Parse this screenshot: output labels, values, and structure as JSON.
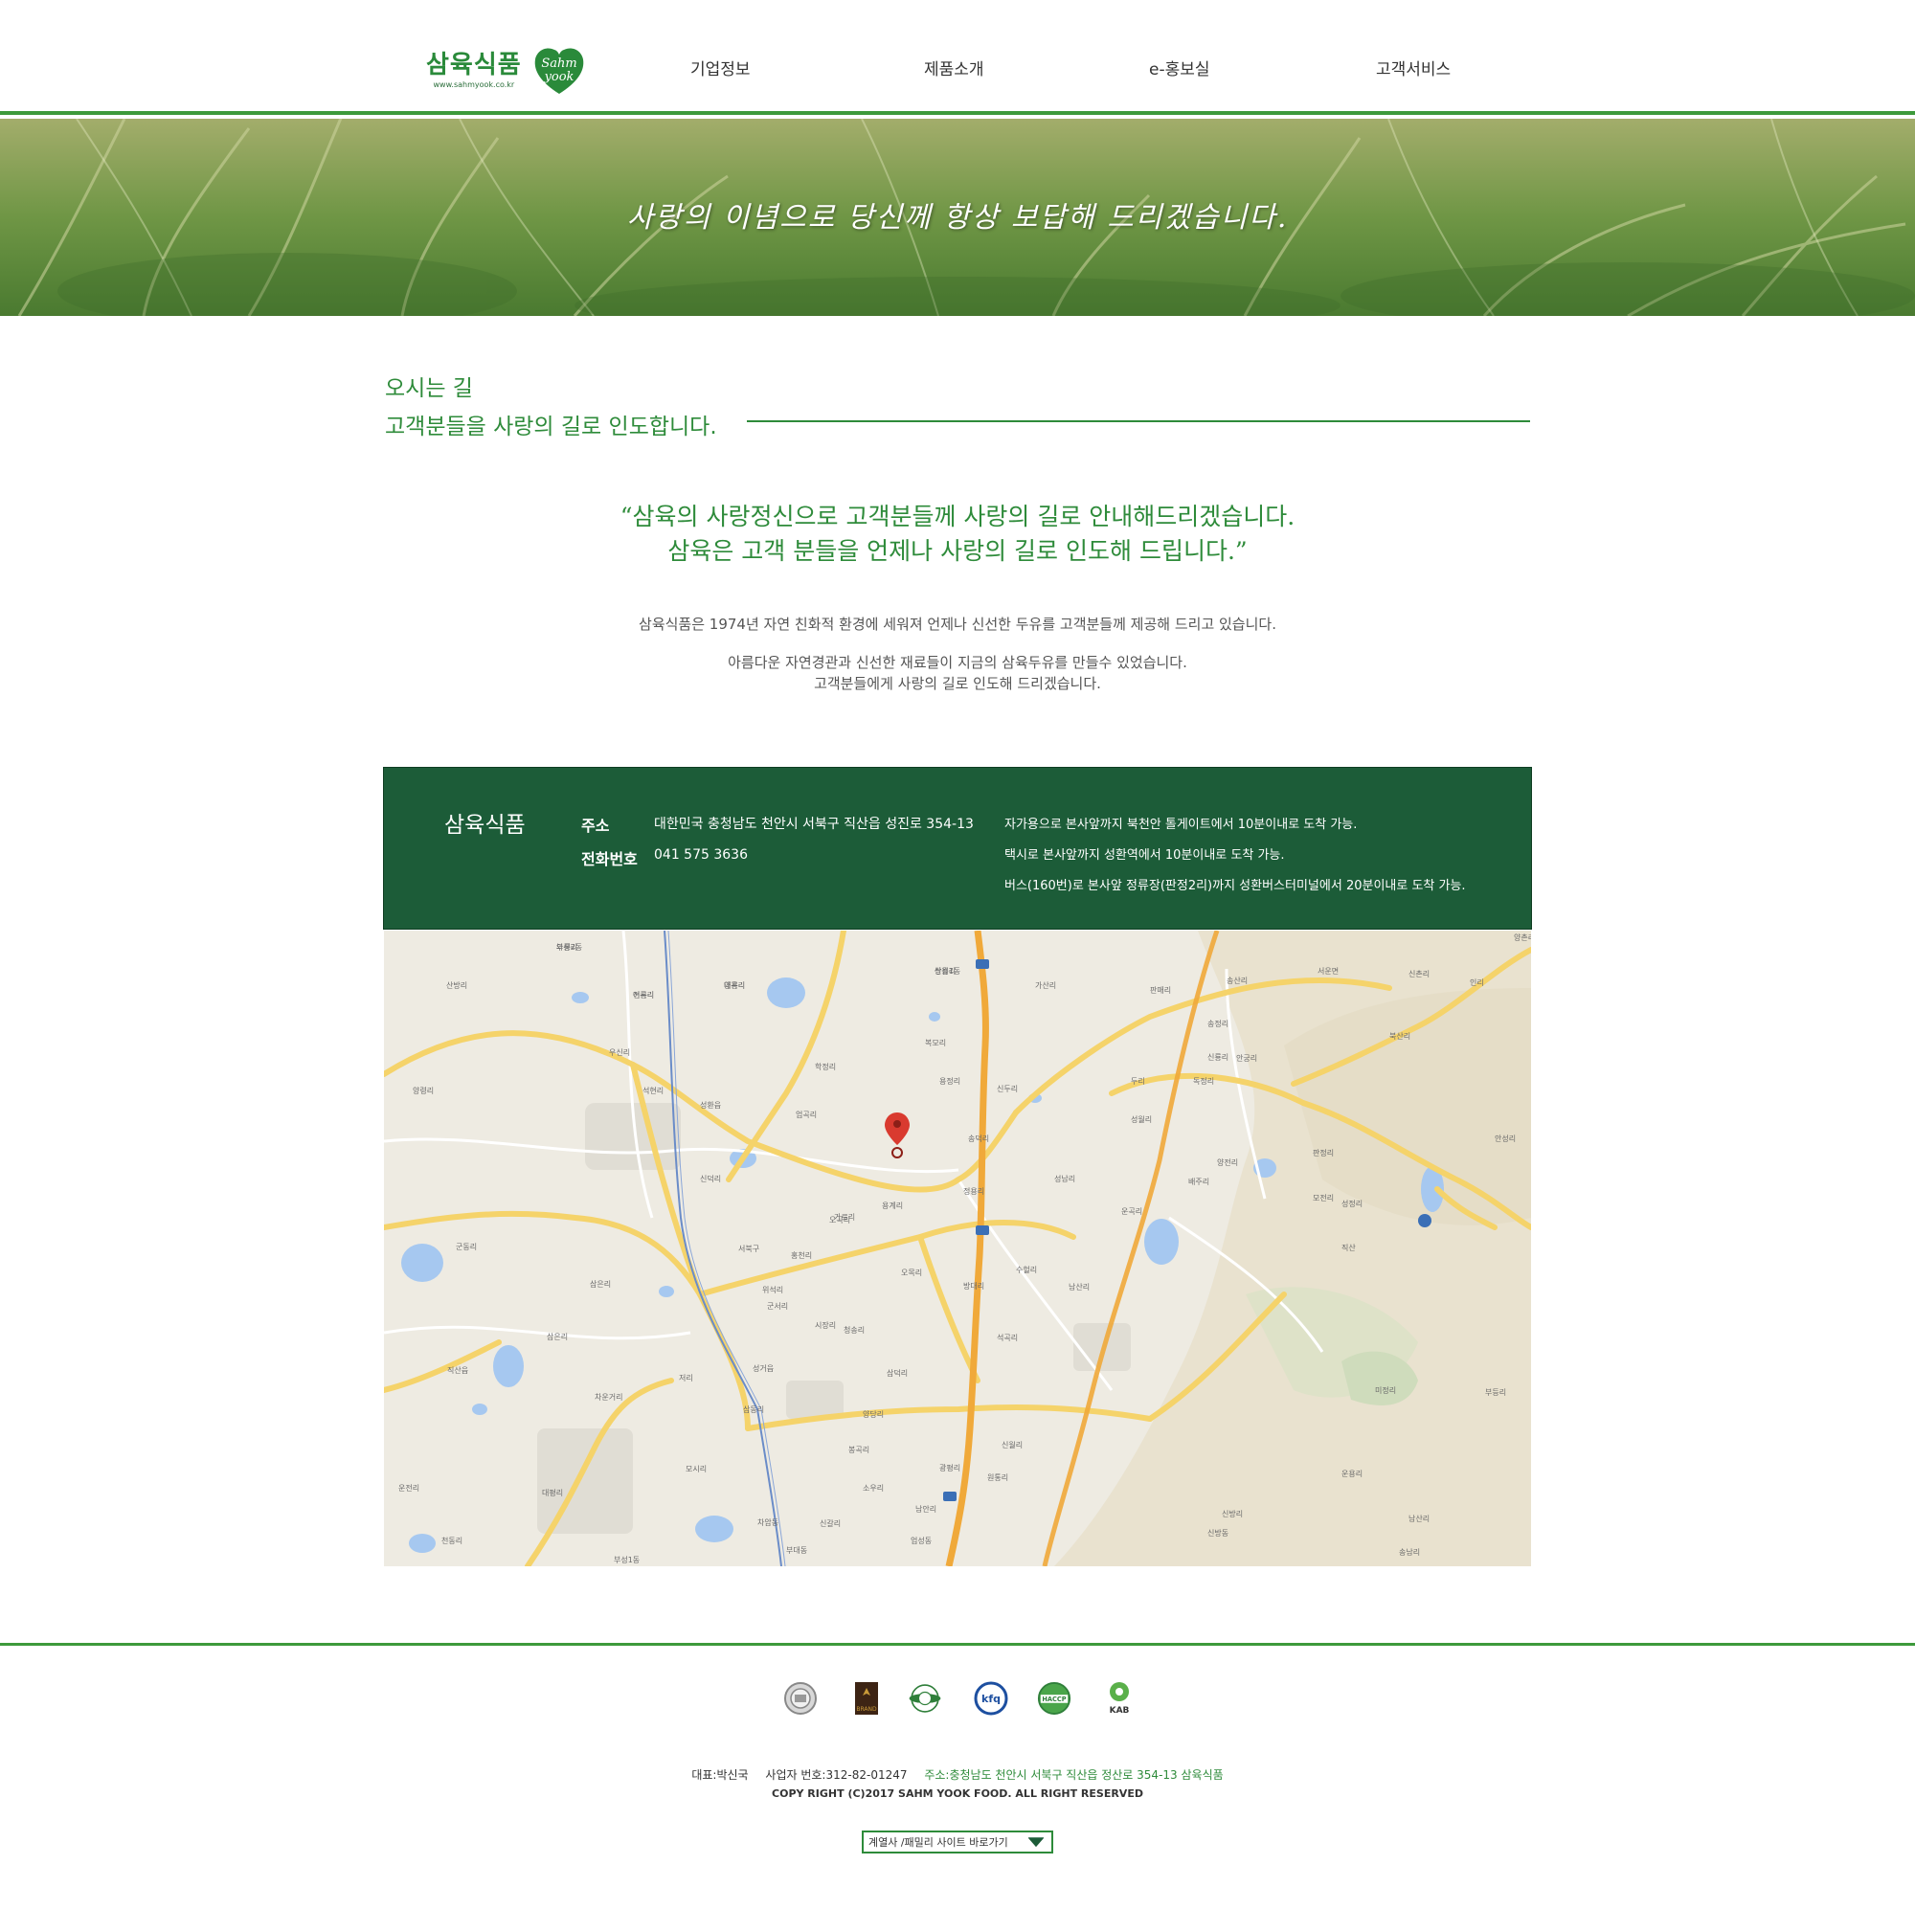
{
  "brand": {
    "name": "삼육식품",
    "url": "www.sahmyook.co.kr",
    "badge_line1": "Sahm",
    "badge_line2": "yook",
    "primary_color": "#2e8b3a",
    "dark_green": "#1c5c38"
  },
  "nav": {
    "items": [
      {
        "label": "기업정보"
      },
      {
        "label": "제품소개"
      },
      {
        "label": "e-홍보실"
      },
      {
        "label": "고객서비스"
      }
    ]
  },
  "hero": {
    "slogan": "사랑의 이념으로 당신께 항상 보답해 드리겠습니다."
  },
  "section": {
    "title": "오시는 길",
    "subtitle": "고객분들을 사랑의 길로 인도합니다."
  },
  "quote": {
    "line1": "“삼육의 사랑정신으로 고객분들께 사랑의 길로 안내해드리겠습니다.",
    "line2": "삼육은 고객 분들을 언제나 사랑의 길로 인도해 드립니다.”"
  },
  "intro": {
    "p1": "삼육식품은 1974년 자연 친화적 환경에 세워져 언제나 신선한 두유를 고객분들께 제공해 드리고 있습니다.",
    "p2_line1": "아름다운 자연경관과 신선한 재료들이 지금의 삼육두유를 만들수 있었습니다.",
    "p2_line2": "고객분들에게 사랑의 길로 인도해 드리겠습니다."
  },
  "contact": {
    "company": "삼육식품",
    "address_label": "주소",
    "address": "대한민국 충청남도 천안시 서북구 직산읍 성진로 354-13",
    "phone_label": "전화번호",
    "phone": "041 575 3636",
    "directions": [
      "자가용으로 본사앞까지 북천안 톨게이트에서 10분이내로 도착 가능.",
      "택시로 본사앞까지 성환역에서 10분이내로 도착 가능.",
      "버스(160번)로 본사앞 정류장(판정2리)까지 성환버스터미널에서 20분이내로 도착 가능."
    ]
  },
  "map": {
    "marker_icon": "map-pin-icon",
    "places": [
      "와룡리",
      "어룡리",
      "대홍리",
      "산월리",
      "가산리",
      "판매리",
      "송산리",
      "서운면",
      "신촌리",
      "인리",
      "양촌리",
      "산방리",
      "우신리",
      "복모리",
      "송정리",
      "북산리",
      "양령리",
      "석현리",
      "성환읍",
      "학정리",
      "용정리",
      "신두리",
      "두리",
      "독정리",
      "안궁리",
      "신룡리",
      "엄곡리",
      "송덕리",
      "성월리",
      "양전리",
      "판정리",
      "안성리",
      "신덕리",
      "성남리",
      "정용리",
      "배주리",
      "성정리",
      "모전리",
      "용계리",
      "가로리",
      "홍천리",
      "운곡리",
      "직산",
      "군동리",
      "서북구",
      "오곡리",
      "오목리",
      "시장리",
      "방대리",
      "위석리",
      "수헐리",
      "군서리",
      "남산리",
      "삼은리",
      "석곡리",
      "삼덕리",
      "청송리",
      "삼은리",
      "직산읍",
      "성거읍",
      "저리",
      "삼동리",
      "양당리",
      "봉곡리",
      "미정리",
      "부등리",
      "차운거리",
      "모시리",
      "소우리",
      "신월리",
      "원통리",
      "운용리",
      "운전리",
      "대평리",
      "신갈리",
      "업성동",
      "신방동",
      "신방리",
      "송남리",
      "남산리",
      "남안리",
      "광평리",
      "천동리",
      "부성1동",
      "부대동",
      "차암동",
      "부성2동",
      "전곡리",
      "양곡리",
      "쌍용1동"
    ]
  },
  "footer": {
    "certifications": [
      {
        "icon": "seal-icon"
      },
      {
        "icon": "brand-icon",
        "label": "BRAND"
      },
      {
        "icon": "haccp-seal-icon"
      },
      {
        "icon": "kfq-icon",
        "label": "kfq"
      },
      {
        "icon": "haccp-icon",
        "label": "HACCP"
      },
      {
        "icon": "kab-icon",
        "label": "KAB"
      }
    ],
    "ceo": "대표:박신국",
    "biz_no": "사업자 번호:312-82-01247",
    "address": "주소:충청남도 천안시 서북구 직산읍 정산로 354-13 삼육식품",
    "copyright": "COPY RIGHT (C)2017 SAHM YOOK FOOD. ALL RIGHT RESERVED",
    "family_site_label": "계열사 /패밀리 사이트 바로가기"
  }
}
